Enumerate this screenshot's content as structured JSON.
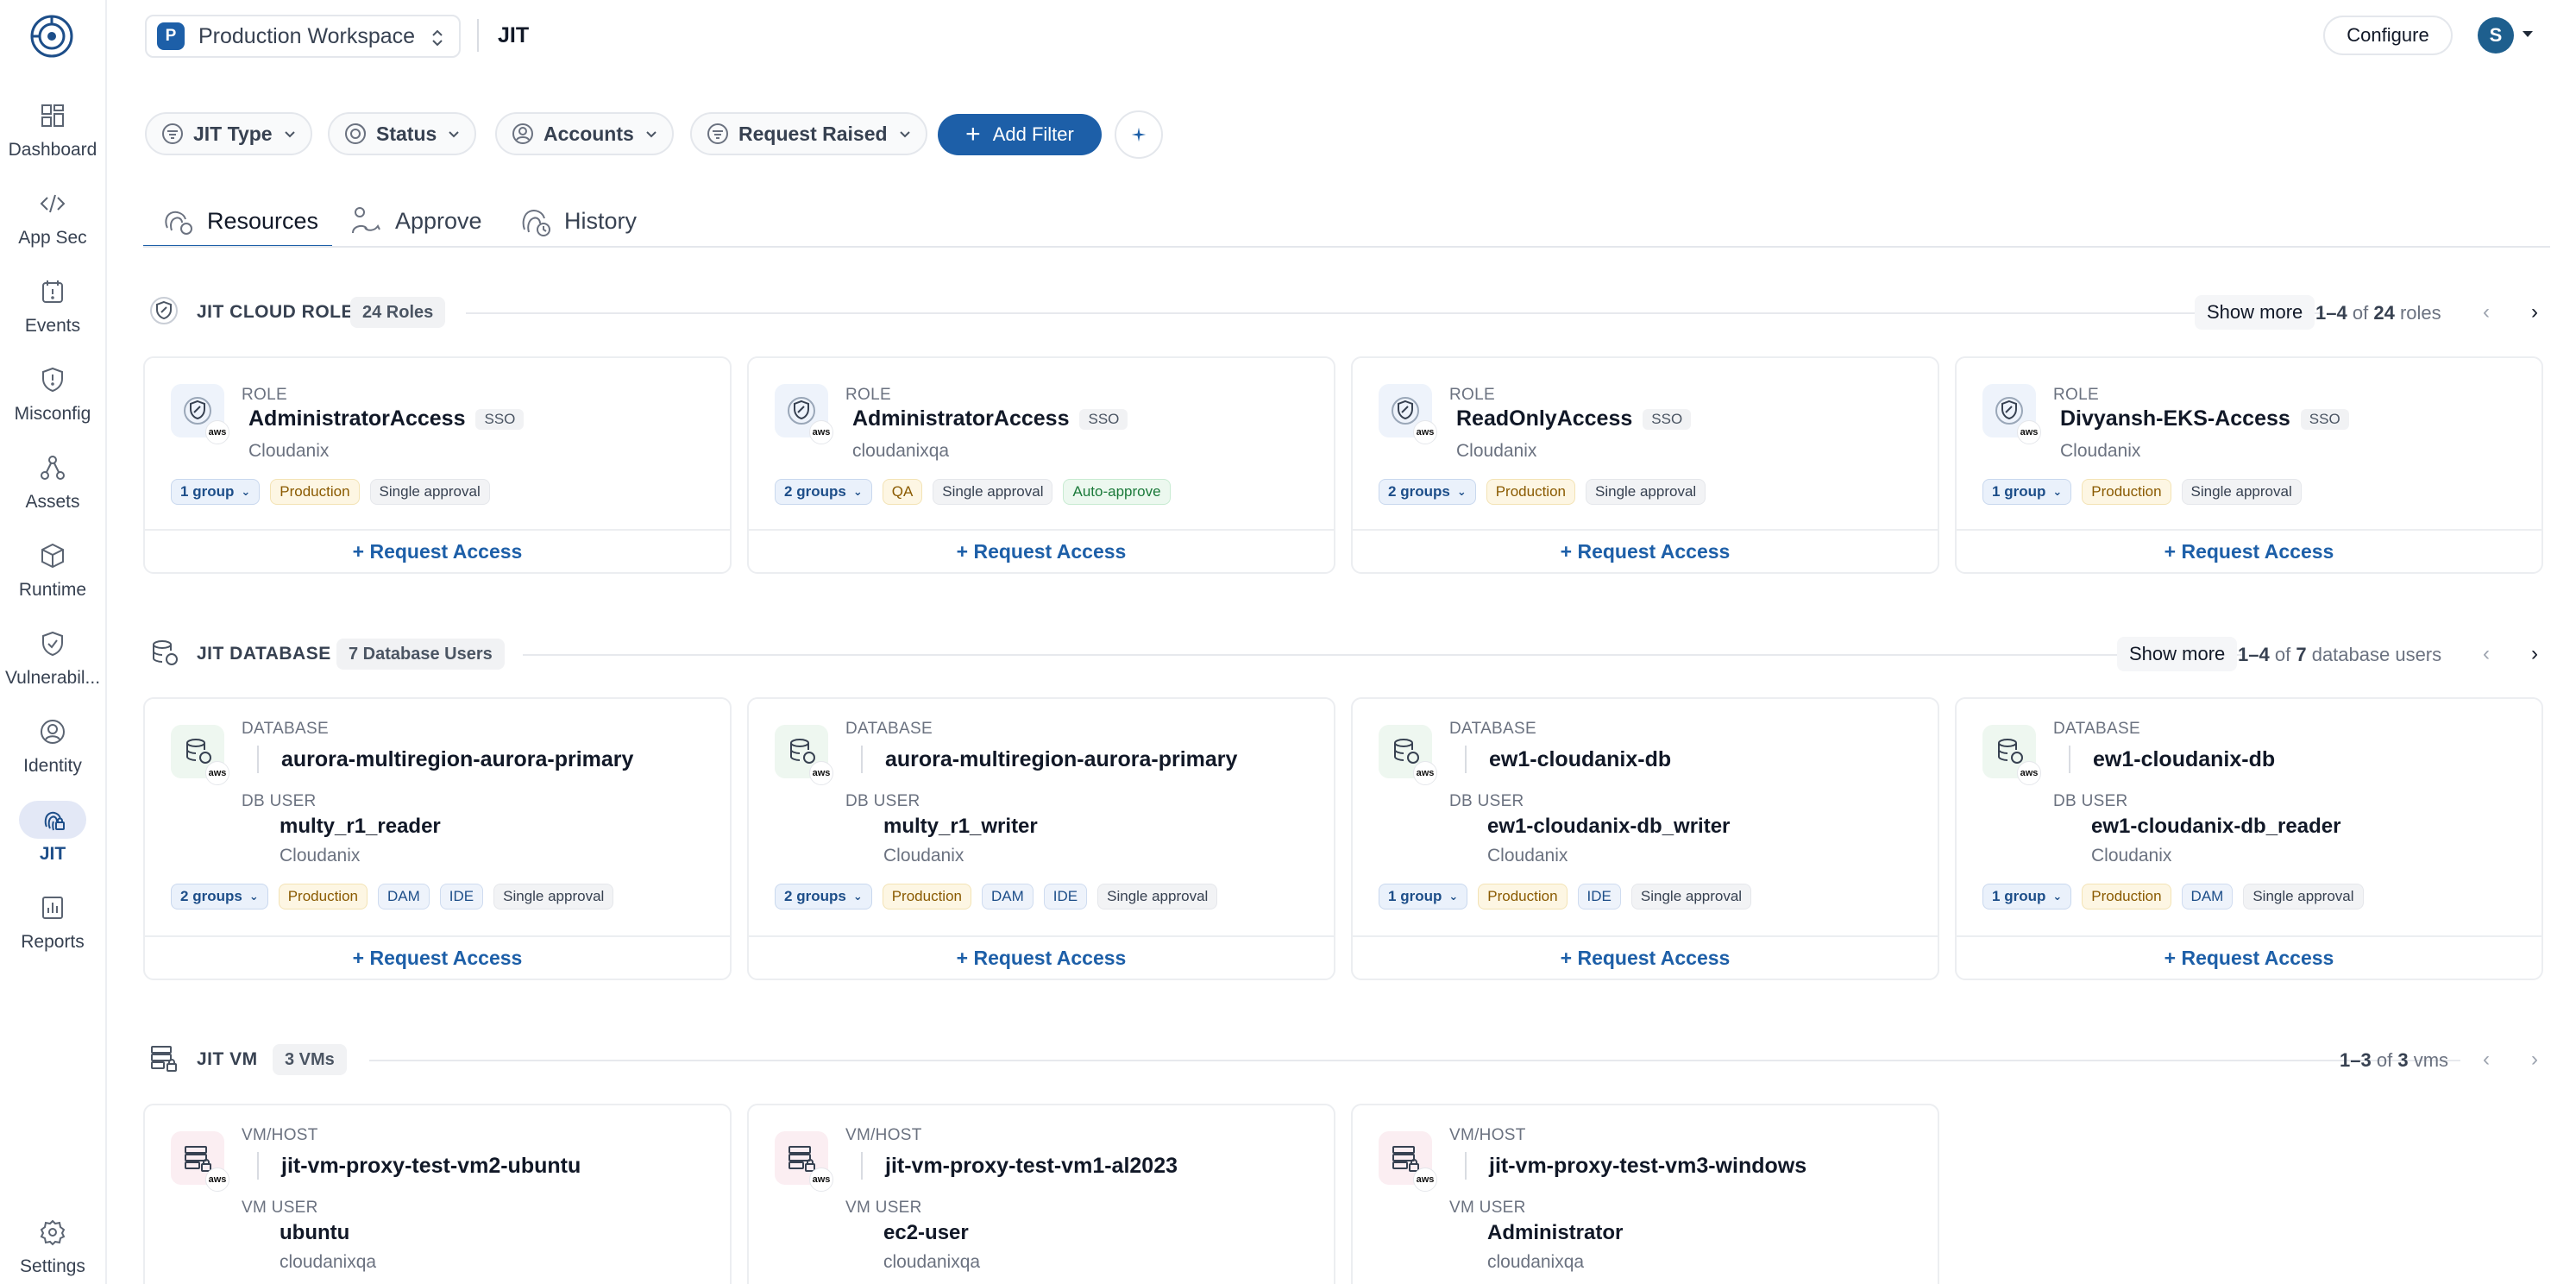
{
  "sidebar": {
    "items": [
      {
        "label": "Dashboard",
        "icon": "dashboard-icon"
      },
      {
        "label": "App Sec",
        "icon": "code-icon"
      },
      {
        "label": "Events",
        "icon": "events-icon"
      },
      {
        "label": "Misconfig",
        "icon": "shield-alert-icon"
      },
      {
        "label": "Assets",
        "icon": "assets-icon"
      },
      {
        "label": "Runtime",
        "icon": "cube-icon"
      },
      {
        "label": "Vulnerabil...",
        "icon": "shield-check-icon"
      },
      {
        "label": "Identity",
        "icon": "identity-icon"
      },
      {
        "label": "JIT",
        "icon": "fingerprint-icon",
        "active": true
      },
      {
        "label": "Reports",
        "icon": "reports-icon"
      }
    ],
    "settings": {
      "label": "Settings",
      "icon": "settings-icon"
    }
  },
  "header": {
    "workspace_initial": "P",
    "workspace_name": "Production Workspace",
    "page_title": "JIT",
    "configure_label": "Configure",
    "user_initial": "S"
  },
  "filters": [
    {
      "label": "JIT Type",
      "icon": "filter-icon"
    },
    {
      "label": "Status",
      "icon": "status-icon"
    },
    {
      "label": "Accounts",
      "icon": "account-icon"
    },
    {
      "label": "Request Raised",
      "icon": "filter-icon"
    }
  ],
  "add_filter_label": "Add Filter",
  "tabs": [
    {
      "label": "Resources",
      "icon": "resources-icon",
      "active": true
    },
    {
      "label": "Approve",
      "icon": "approve-icon"
    },
    {
      "label": "History",
      "icon": "history-icon"
    }
  ],
  "sections": {
    "cloud_role": {
      "title": "JIT CLOUD ROLE",
      "count": "24 Roles",
      "show_more": "Show more",
      "range": "1–4",
      "of": "of",
      "total": "24",
      "unit": "roles",
      "cards": [
        {
          "kind": "ROLE",
          "name": "AdministratorAccess",
          "badge": "SSO",
          "account": "Cloudanix",
          "group": "1",
          "group_unit": "group",
          "tags": [
            {
              "t": "Production",
              "c": "env"
            },
            {
              "t": "Single approval",
              "c": ""
            }
          ],
          "cta": "+ Request Access"
        },
        {
          "kind": "ROLE",
          "name": "AdministratorAccess",
          "badge": "SSO",
          "account": "cloudanixqa",
          "group": "2",
          "group_unit": "groups",
          "tags": [
            {
              "t": "QA",
              "c": "env"
            },
            {
              "t": "Single approval",
              "c": ""
            },
            {
              "t": "Auto-approve",
              "c": "green"
            }
          ],
          "cta": "+ Request Access"
        },
        {
          "kind": "ROLE",
          "name": "ReadOnlyAccess",
          "badge": "SSO",
          "account": "Cloudanix",
          "group": "2",
          "group_unit": "groups",
          "tags": [
            {
              "t": "Production",
              "c": "env"
            },
            {
              "t": "Single approval",
              "c": ""
            }
          ],
          "cta": "+ Request Access"
        },
        {
          "kind": "ROLE",
          "name": "Divyansh-EKS-Access",
          "badge": "SSO",
          "account": "Cloudanix",
          "group": "1",
          "group_unit": "group",
          "tags": [
            {
              "t": "Production",
              "c": "env"
            },
            {
              "t": "Single approval",
              "c": ""
            }
          ],
          "cta": "+ Request Access"
        }
      ]
    },
    "database": {
      "title": "JIT DATABASE",
      "count": "7 Database Users",
      "show_more": "Show more",
      "range": "1–4",
      "of": "of",
      "total": "7",
      "unit": "database users",
      "cards": [
        {
          "kind": "DATABASE",
          "name": "aurora-multiregion-aurora-primary",
          "user_kind": "DB USER",
          "user": "multy_r1_reader",
          "account": "Cloudanix",
          "group": "2",
          "group_unit": "groups",
          "tags": [
            {
              "t": "Production",
              "c": "env"
            },
            {
              "t": "DAM",
              "c": "blue"
            },
            {
              "t": "IDE",
              "c": "blue"
            },
            {
              "t": "Single approval",
              "c": ""
            }
          ],
          "cta": "+ Request Access"
        },
        {
          "kind": "DATABASE",
          "name": "aurora-multiregion-aurora-primary",
          "user_kind": "DB USER",
          "user": "multy_r1_writer",
          "account": "Cloudanix",
          "group": "2",
          "group_unit": "groups",
          "tags": [
            {
              "t": "Production",
              "c": "env"
            },
            {
              "t": "DAM",
              "c": "blue"
            },
            {
              "t": "IDE",
              "c": "blue"
            },
            {
              "t": "Single approval",
              "c": ""
            }
          ],
          "cta": "+ Request Access"
        },
        {
          "kind": "DATABASE",
          "name": "ew1-cloudanix-db",
          "user_kind": "DB USER",
          "user": "ew1-cloudanix-db_writer",
          "account": "Cloudanix",
          "group": "1",
          "group_unit": "group",
          "tags": [
            {
              "t": "Production",
              "c": "env"
            },
            {
              "t": "IDE",
              "c": "blue"
            },
            {
              "t": "Single approval",
              "c": ""
            }
          ],
          "cta": "+ Request Access"
        },
        {
          "kind": "DATABASE",
          "name": "ew1-cloudanix-db",
          "user_kind": "DB USER",
          "user": "ew1-cloudanix-db_reader",
          "account": "Cloudanix",
          "group": "1",
          "group_unit": "group",
          "tags": [
            {
              "t": "Production",
              "c": "env"
            },
            {
              "t": "DAM",
              "c": "blue"
            },
            {
              "t": "Single approval",
              "c": ""
            }
          ],
          "cta": "+ Request Access"
        }
      ]
    },
    "vm": {
      "title": "JIT VM",
      "count": "3 VMs",
      "range": "1–3",
      "of": "of",
      "total": "3",
      "unit": "vms",
      "cards": [
        {
          "kind": "VM/HOST",
          "name": "jit-vm-proxy-test-vm2-ubuntu",
          "user_kind": "VM USER",
          "user": "ubuntu",
          "account": "cloudanixqa"
        },
        {
          "kind": "VM/HOST",
          "name": "jit-vm-proxy-test-vm1-al2023",
          "user_kind": "VM USER",
          "user": "ec2-user",
          "account": "cloudanixqa"
        },
        {
          "kind": "VM/HOST",
          "name": "jit-vm-proxy-test-vm3-windows",
          "user_kind": "VM USER",
          "user": "Administrator",
          "account": "cloudanixqa"
        }
      ]
    }
  },
  "colors": {
    "accent": "#1d5fa8",
    "active_nav_bg": "#e3e8f6",
    "env_tag": "#fdf6e3"
  }
}
